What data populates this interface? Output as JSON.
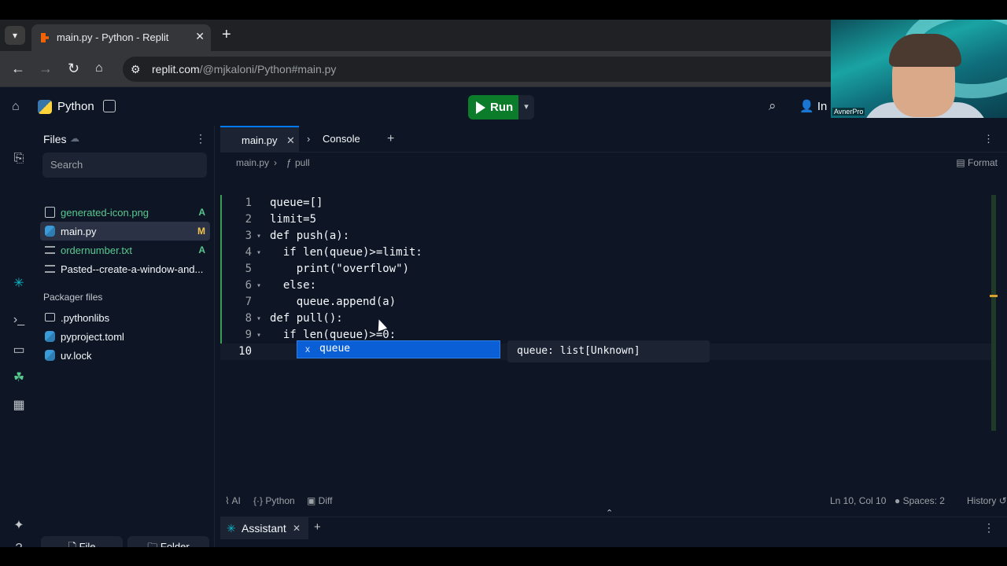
{
  "browser": {
    "tab_title": "main.py - Python - Replit",
    "tab_close": "✕",
    "new_tab": "+",
    "url_host": "replit.com",
    "url_path": "/@mjkaloni/Python#main.py"
  },
  "topbar": {
    "project_name": "Python",
    "run_label": "Run",
    "invite_label": "In"
  },
  "files_panel": {
    "title": "Files",
    "search_placeholder": "Search",
    "files": [
      {
        "name": "generated-icon.png",
        "status": "A",
        "status_color": "#58c98e",
        "icon": "image-icon"
      },
      {
        "name": "main.py",
        "status": "M",
        "status_color": "#f0c44d",
        "icon": "python-file-icon"
      },
      {
        "name": "ordernumber.txt",
        "status": "A",
        "status_color": "#58c98e",
        "icon": "text-file-icon"
      },
      {
        "name": "Pasted--create-a-window-and...",
        "status": "",
        "status_color": "",
        "icon": "text-file-icon"
      }
    ],
    "packager_label": "Packager files",
    "packager_files": [
      {
        "name": ".pythonlibs",
        "icon": "folder-icon"
      },
      {
        "name": "pyproject.toml",
        "icon": "python-file-icon"
      },
      {
        "name": "uv.lock",
        "icon": "python-file-icon"
      }
    ],
    "new_file_label": "File",
    "new_folder_label": "Folder"
  },
  "editor": {
    "tabs": [
      {
        "label": "main.py",
        "active": true
      },
      {
        "label": "Console",
        "active": false
      }
    ],
    "breadcrumb_file": "main.py",
    "breadcrumb_symbol": "pull",
    "format_label": "Format",
    "lines": [
      {
        "n": "1",
        "text": "queue=[]"
      },
      {
        "n": "2",
        "text": "limit=5"
      },
      {
        "n": "3",
        "text": "def push(a):"
      },
      {
        "n": "4",
        "text": "  if len(queue)>=limit:"
      },
      {
        "n": "5",
        "text": "    print(\"overflow\")"
      },
      {
        "n": "6",
        "text": "  else:"
      },
      {
        "n": "7",
        "text": "    queue.append(a)"
      },
      {
        "n": "8",
        "text": "def pull():"
      },
      {
        "n": "9",
        "text": "  if len(queue)>=0:"
      },
      {
        "n": "10",
        "text": "    queue"
      }
    ],
    "autocomplete_kind": "x",
    "autocomplete_item": "queue",
    "hover_info": "queue: list[Unknown]"
  },
  "statusbar": {
    "ai": "AI",
    "language": "Python",
    "diff": "Diff",
    "position": "Ln 10, Col 10",
    "spaces": "Spaces: 2",
    "history": "History"
  },
  "bottom_panel": {
    "tab_label": "Assistant"
  },
  "webcam": {
    "name_tag": "AvnerPro"
  }
}
